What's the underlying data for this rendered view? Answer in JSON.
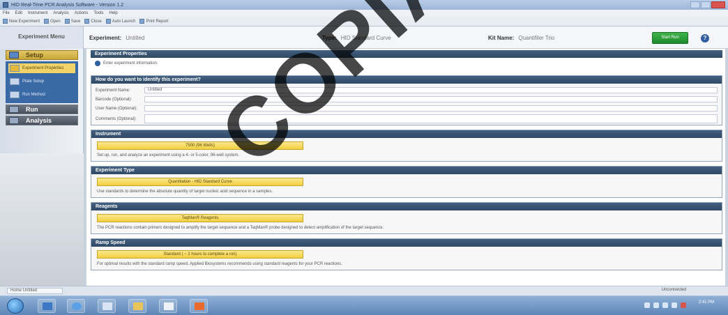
{
  "window": {
    "title": "HID Real-Time PCR Analysis Software - Version 1.2"
  },
  "menubar": {
    "items": [
      "File",
      "Edit",
      "Instrument",
      "Analysis",
      "Actions",
      "Tools",
      "Help"
    ]
  },
  "toolbar": {
    "items": [
      "New Experiment",
      "Open",
      "Save",
      "Close",
      "Auto Launch",
      "Print Report"
    ]
  },
  "header": {
    "nav_title": "Experiment Menu",
    "experiment_label": "Experiment:",
    "experiment_value": "Untitled",
    "type_label": "Type:",
    "type_value": "HID Standard Curve",
    "kit_label": "Kit Name:",
    "kit_value": "Quantifiler Trio",
    "start_run_label": "Start Run"
  },
  "leftnav": {
    "setup_label": "Setup",
    "run_label": "Run",
    "analysis_label": "Analysis",
    "sub_items": [
      {
        "label": "Experiment Properties"
      },
      {
        "label": "Plate Setup"
      },
      {
        "label": "Run Method"
      }
    ]
  },
  "main": {
    "panel_title": "Experiment Properties",
    "info_text": "Enter experiment information.",
    "identify": {
      "title": "How do you want to identify this experiment?",
      "fields": [
        {
          "label": "Experiment Name:",
          "value": "Untitled"
        },
        {
          "label": "Barcode (Optional):",
          "value": ""
        },
        {
          "label": "User Name (Optional):",
          "value": ""
        },
        {
          "label": "Comments (Optional):",
          "value": ""
        }
      ]
    },
    "instrument": {
      "title": "Instrument",
      "selection": "7500 (96 Wells)",
      "desc": "Set up, run, and analyze an experiment using a 4- or 5-color, 96-well system."
    },
    "experiment_type": {
      "title": "Experiment Type",
      "selection": "Quantitation - HID Standard Curve",
      "desc": "Use standards to determine the absolute quantity of target nucleic acid sequence in a samples."
    },
    "reagents": {
      "title": "Reagents",
      "selection": "TaqMan® Reagents",
      "desc": "The PCR reactions contain primers designed to amplify the target sequence and a TaqMan® probe designed to detect amplification of the target sequence."
    },
    "ramp_speed": {
      "title": "Ramp Speed",
      "selection": "Standard ( ~ 2 hours to complete a run)",
      "desc": "For optimal results with the standard ramp speed, Applied Biosystems recommends using standard reagents for your PCR reactions."
    }
  },
  "statusbar": {
    "tab_label": "Home  Untitled",
    "right_text": "Unconnected"
  },
  "taskbar": {
    "clock_time": "2:41 PM"
  },
  "watermark": {
    "text": "COPIA NO C"
  },
  "colors": {
    "start_run": "#1f8a2c",
    "section_header": "#2f4965",
    "selection_yellow": "#f2cf3f",
    "setup_active": "#c9a73a"
  }
}
